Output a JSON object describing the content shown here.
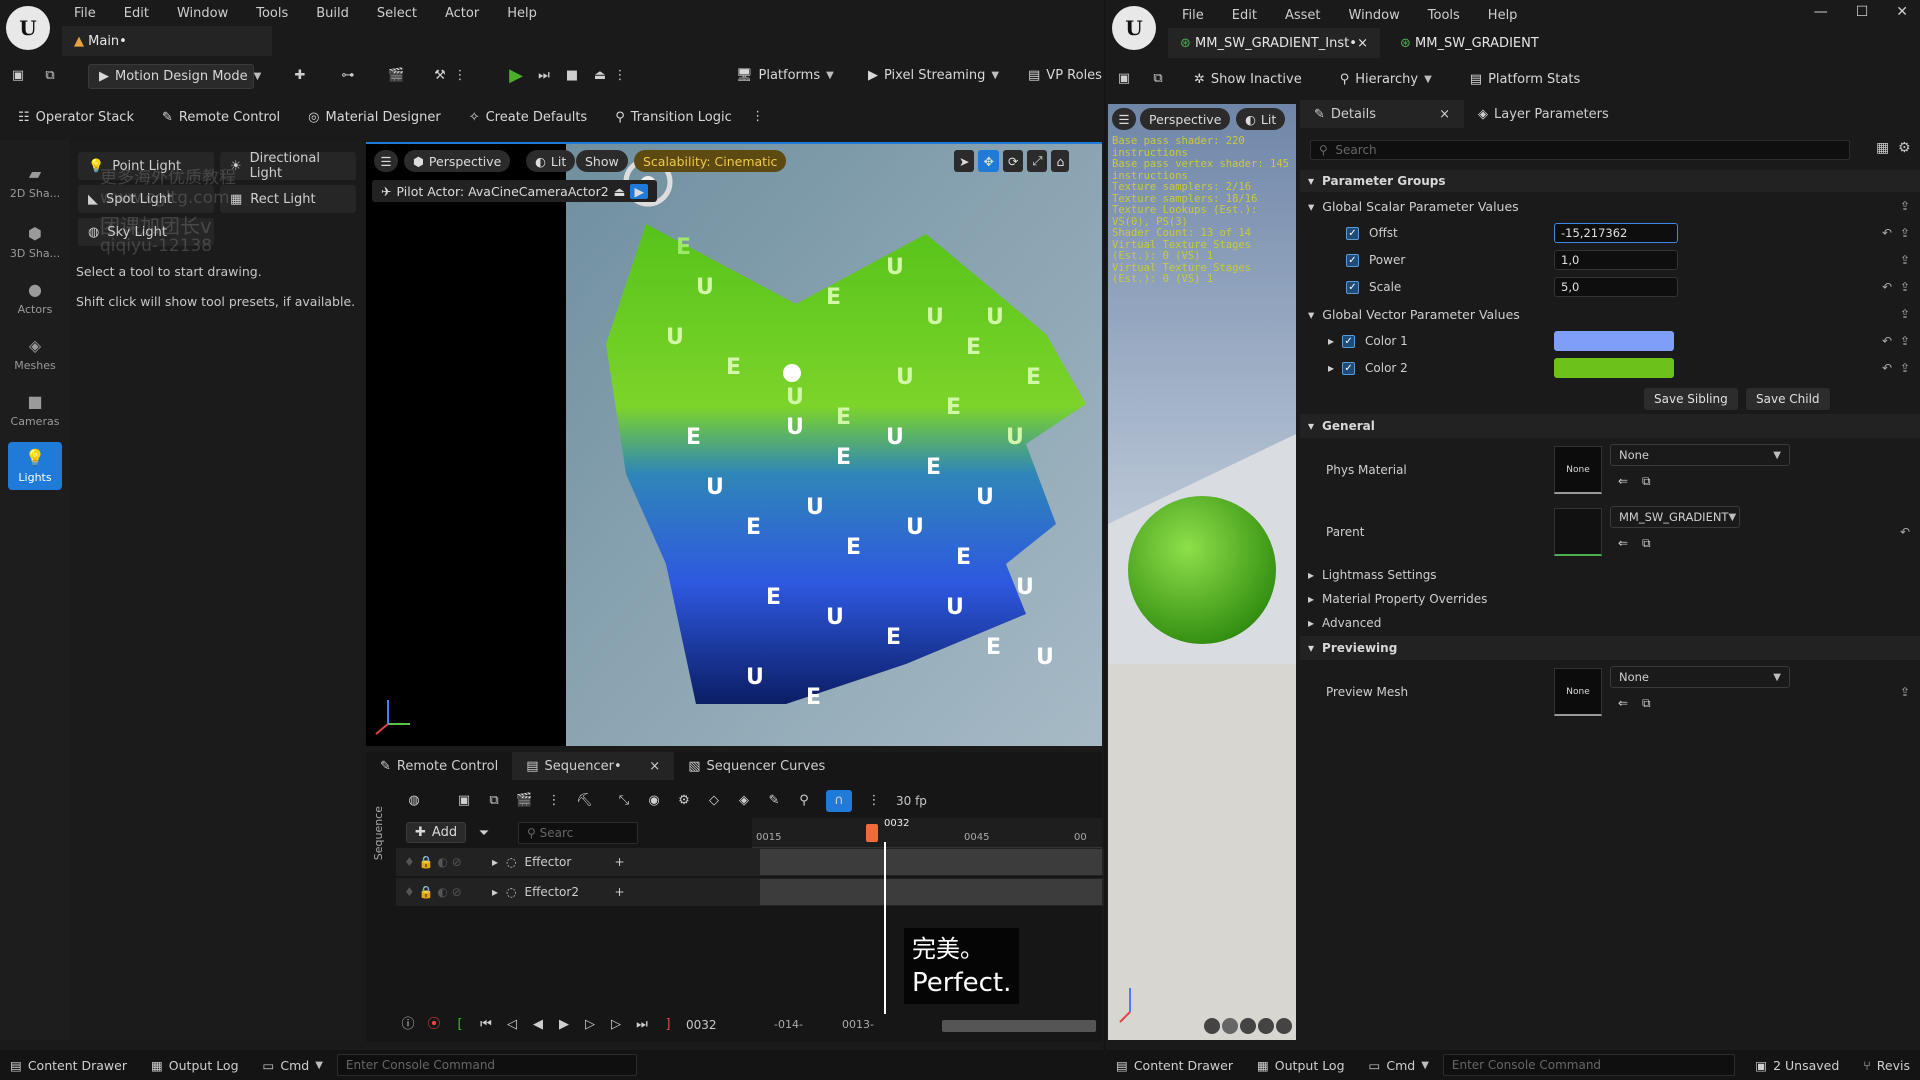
{
  "left_window": {
    "menu": [
      "File",
      "Edit",
      "Window",
      "Tools",
      "Build",
      "Select",
      "Actor",
      "Help"
    ],
    "level_tab": "Main•",
    "mode_button": "Motion Design Mode",
    "toolbar_right": {
      "platforms": "Platforms",
      "pixel_streaming": "Pixel Streaming",
      "vp_roles": "VP Roles"
    },
    "tool_row": [
      "Operator Stack",
      "Remote Control",
      "Material Designer",
      "Create Defaults",
      "Transition Logic"
    ],
    "sidebar": [
      {
        "label": "2D Sha...",
        "icon": "2d-shape-icon"
      },
      {
        "label": "3D Sha...",
        "icon": "3d-shape-icon"
      },
      {
        "label": "Actors",
        "icon": "actors-icon"
      },
      {
        "label": "Meshes",
        "icon": "meshes-icon"
      },
      {
        "label": "Cameras",
        "icon": "cameras-icon"
      },
      {
        "label": "Lights",
        "icon": "lights-icon"
      }
    ],
    "lights": [
      "Point Light",
      "Directional Light",
      "Spot Light",
      "Rect Light",
      "Sky Light"
    ],
    "hint_line1": "Select a tool to start drawing.",
    "hint_line2": "Shift click will show tool presets, if available.",
    "watermark": [
      "更多海外优质教程",
      "www.cgltg.com",
      "团课加团长v",
      "qiqiyu-12138"
    ],
    "viewport": {
      "perspective": "Perspective",
      "lit": "Lit",
      "show": "Show",
      "scalability": "Scalability: Cinematic",
      "pilot": "Pilot Actor: AvaCineCameraActor2",
      "letters": [
        "U",
        "E"
      ]
    },
    "sequencer": {
      "tabs": [
        "Remote Control",
        "Sequencer•",
        "Sequencer Curves"
      ],
      "add": "Add",
      "search_placeholder": "Searc",
      "fps": "30 fp",
      "playhead": "0032",
      "ruler": [
        "0015",
        "0045",
        "00"
      ],
      "tracks": [
        "Effector",
        "Effector2"
      ],
      "current_frame": "0032",
      "range_start": "-014-",
      "range_end": "0013-",
      "subtitle_cn": "完美。",
      "subtitle_en": "Perfect."
    },
    "status": {
      "content_drawer": "Content Drawer",
      "output_log": "Output Log",
      "cmd": "Cmd",
      "console_placeholder": "Enter Console Command"
    }
  },
  "right_window": {
    "menu": [
      "File",
      "Edit",
      "Asset",
      "Window",
      "Tools",
      "Help"
    ],
    "tabs": [
      "MM_SW_GRADIENT_Inst•",
      "MM_SW_GRADIENT"
    ],
    "toolbar": {
      "show_inactive": "Show Inactive",
      "hierarchy": "Hierarchy",
      "platform_stats": "Platform Stats"
    },
    "preview": {
      "perspective": "Perspective",
      "lit": "Lit",
      "stats": [
        "Base pass shader: 220 instructions",
        "Base pass vertex shader: 145 instructions",
        "Texture samplers: 2/16",
        "Texture samplers: 18/16",
        "Texture Lookups (Est.): VS(0), PS(3)",
        "Shader Count: 13 of 14",
        "Virtual Texture Stages (Est.): 0 (VS) 1",
        "Virtual Texture Stages (Est.): 0 (VS) 1"
      ]
    },
    "details_tab": "Details",
    "layer_tab": "Layer Parameters",
    "search_placeholder": "Search",
    "sections": {
      "parameter_groups": "Parameter Groups",
      "global_scalar": "Global Scalar Parameter Values",
      "global_vector": "Global Vector Parameter Values",
      "general": "General",
      "previewing": "Previewing"
    },
    "scalars": [
      {
        "name": "Offst",
        "value": "-15,217362"
      },
      {
        "name": "Power",
        "value": "1,0"
      },
      {
        "name": "Scale",
        "value": "5,0"
      }
    ],
    "vectors": [
      {
        "name": "Color 1",
        "color": "#7f9ef7"
      },
      {
        "name": "Color 2",
        "color": "#6cc21a"
      }
    ],
    "save_sibling": "Save Sibling",
    "save_child": "Save Child",
    "phys_material": {
      "label": "Phys Material",
      "thumb": "None",
      "value": "None"
    },
    "parent": {
      "label": "Parent",
      "value": "MM_SW_GRADIENT"
    },
    "collapsed": [
      "Lightmass Settings",
      "Material Property Overrides",
      "Advanced"
    ],
    "preview_mesh": {
      "label": "Preview Mesh",
      "thumb": "None",
      "value": "None"
    },
    "status": {
      "content_drawer": "Content Drawer",
      "output_log": "Output Log",
      "cmd": "Cmd",
      "console_placeholder": "Enter Console Command",
      "unsaved": "2 Unsaved",
      "revision": "Revis"
    }
  }
}
